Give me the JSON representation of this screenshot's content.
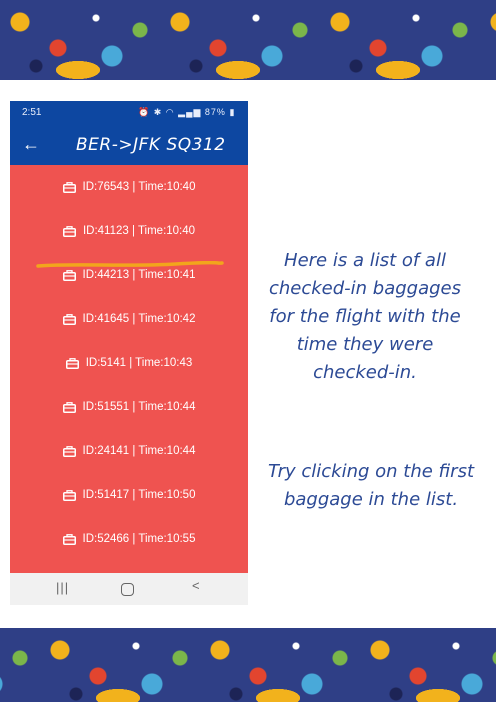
{
  "colors": {
    "appbar": "#0d47a1",
    "list_background": "#ef5350",
    "highlight": "#f2a51c",
    "instruction_text": "#2c4a95"
  },
  "phone": {
    "status_time": "2:51",
    "status_battery": "87%",
    "status_icons": [
      "alarm-icon",
      "bluetooth-icon",
      "wifi-icon",
      "signal-icon",
      "battery-icon"
    ],
    "back_icon": "arrow-left-icon",
    "title": "BER->JFK SQ312",
    "items": [
      {
        "text": "ID:76543 | Time:10:40",
        "icon": "suitcase-icon",
        "highlighted": true
      },
      {
        "text": "ID:41123 | Time:10:40",
        "icon": "suitcase-icon"
      },
      {
        "text": "ID:44213 | Time:10:41",
        "icon": "suitcase-icon"
      },
      {
        "text": "ID:41645 | Time:10:42",
        "icon": "suitcase-icon"
      },
      {
        "text": "ID:5141 | Time:10:43",
        "icon": "suitcase-icon"
      },
      {
        "text": "ID:51551 | Time:10:44",
        "icon": "suitcase-icon"
      },
      {
        "text": "ID:24141 | Time:10:44",
        "icon": "suitcase-icon"
      },
      {
        "text": "ID:51417 | Time:10:50",
        "icon": "suitcase-icon"
      },
      {
        "text": "ID:52466 | Time:10:55",
        "icon": "suitcase-icon"
      }
    ],
    "nav": {
      "recents": "|||",
      "home": "",
      "back": "<"
    }
  },
  "instructions": {
    "line1": "Here is a list of all checked-in baggages for the flight with the time they were checked-in.",
    "line2": "Try clicking on the first baggage in the list."
  }
}
